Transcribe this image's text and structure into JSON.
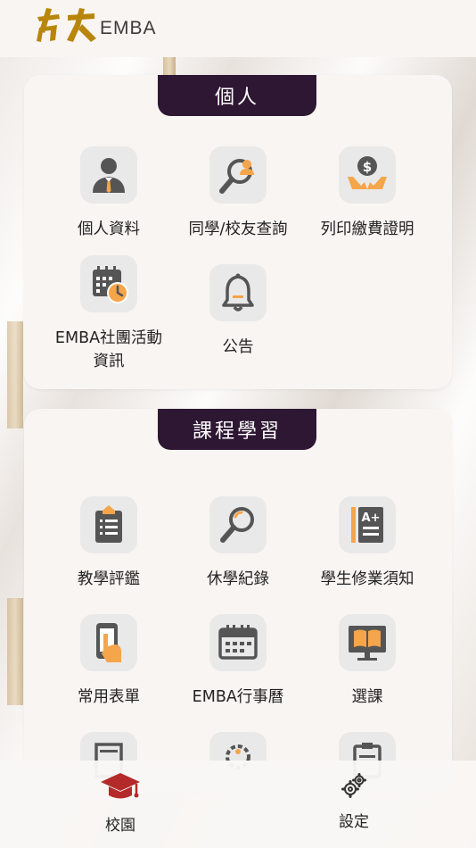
{
  "header": {
    "logo_chinese": "台大",
    "logo_text": "EMBA"
  },
  "sections": [
    {
      "title": "個人",
      "items": [
        {
          "label": "個人資料",
          "icon": "person-icon"
        },
        {
          "label": "同學/校友查詢",
          "icon": "people-search-icon"
        },
        {
          "label": "列印繳費證明",
          "icon": "payment-hands-icon"
        },
        {
          "label": "EMBA社團活動\n資訊",
          "icon": "calendar-clock-icon"
        },
        {
          "label": "公告",
          "icon": "bell-icon"
        }
      ]
    },
    {
      "title": "課程學習",
      "items": [
        {
          "label": "教學評鑑",
          "icon": "clipboard-list-icon"
        },
        {
          "label": "休學紀錄",
          "icon": "magnifier-icon"
        },
        {
          "label": "學生修業須知",
          "icon": "grade-doc-icon"
        },
        {
          "label": "常用表單",
          "icon": "phone-hand-icon"
        },
        {
          "label": "EMBA行事曆",
          "icon": "calendar-icon"
        },
        {
          "label": "選課",
          "icon": "book-monitor-icon"
        }
      ]
    }
  ],
  "tabbar": {
    "campus_label": "校園",
    "settings_label": "設定"
  },
  "colors": {
    "accent_dark": "#2e1733",
    "icon_gray": "#555555",
    "icon_orange": "#f5a54a",
    "logo_gold": "#b8860b",
    "campus_red": "#b42a2a"
  }
}
